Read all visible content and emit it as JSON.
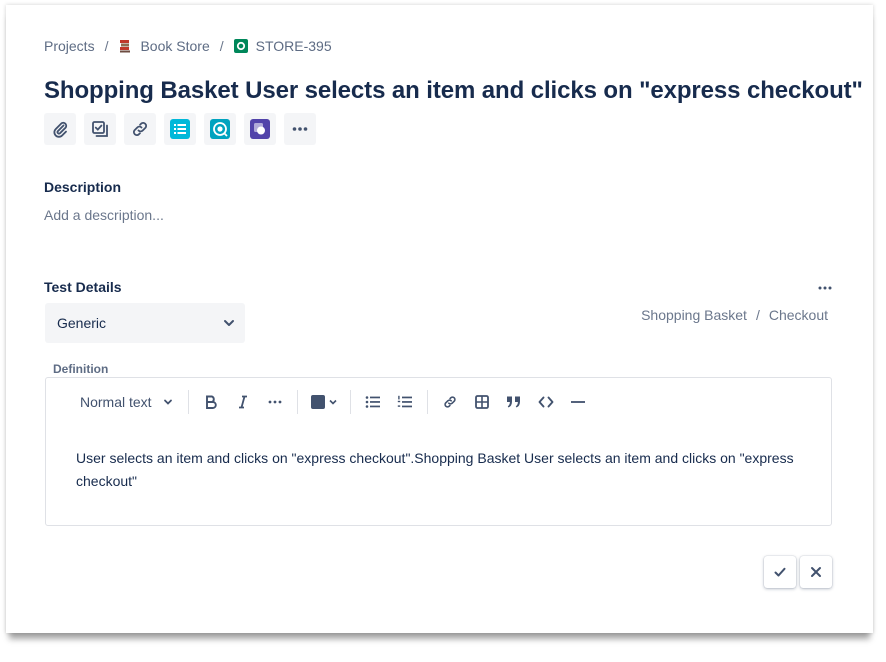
{
  "breadcrumb": {
    "projects": "Projects",
    "project": "Book Store",
    "issue_key": "STORE-395"
  },
  "issue": {
    "title": "Shopping Basket User selects an item and clicks on \"express checkout\""
  },
  "toolbar": {
    "icons": [
      "attachment-icon",
      "subtask-checkbox-icon",
      "link-icon",
      "app-list-icon",
      "app-target-icon",
      "app-screen-icon",
      "more-icon"
    ]
  },
  "description": {
    "label": "Description",
    "placeholder": "Add a description..."
  },
  "test_details": {
    "label": "Test Details",
    "type_selected": "Generic",
    "path_folder": "Shopping Basket",
    "path_item": "Checkout",
    "definition_label": "Definition"
  },
  "editor": {
    "text_style": "Normal text",
    "content": "User selects an item and clicks on \"express checkout\".Shopping Basket User selects an item and clicks on \"express checkout\""
  },
  "colors": {
    "accent_blue": "#0065ff",
    "app_cyan": "#00b8d9",
    "app_teal": "#00a3bf",
    "app_purple": "#5243aa",
    "text_color_swatch": "#42526e"
  }
}
